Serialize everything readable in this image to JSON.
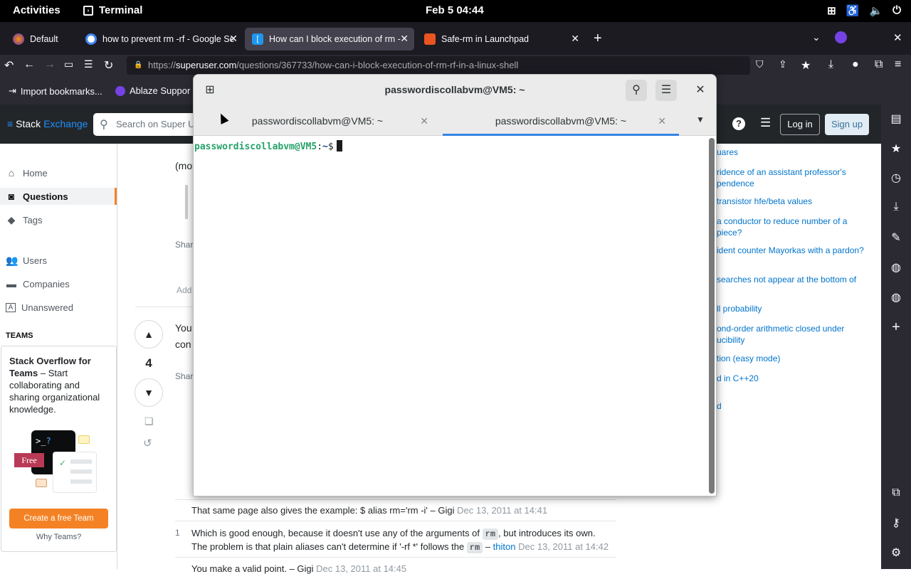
{
  "topbar": {
    "activities": "Activities",
    "app_name": "Terminal",
    "clock": "Feb 5  04:44"
  },
  "browser": {
    "profile_tab": "Default",
    "tabs": [
      {
        "label": "how to prevent rm -rf - Google Se",
        "favicon": "google-icon"
      },
      {
        "label": "How can I block execution of rm -",
        "favicon": "superuser-icon"
      },
      {
        "label": "Safe-rm in Launchpad",
        "favicon": "launchpad-icon"
      }
    ],
    "url_prefix": "https://",
    "url_host": "superuser.com",
    "url_path": "/questions/367733/how-can-i-block-execution-of-rm-rf-in-a-linux-shell",
    "bookmarks": [
      "Import bookmarks...",
      "Ablaze Suppor"
    ]
  },
  "stackexchange": {
    "logo_a": "Stack",
    "logo_b": "Exchange",
    "search_placeholder": "Search on Super U",
    "login": "Log in",
    "signup": "Sign up",
    "nav": [
      {
        "label": "Home",
        "icon": "home-icon"
      },
      {
        "label": "Questions",
        "icon": "questions-icon"
      },
      {
        "label": "Tags",
        "icon": "tag-icon"
      },
      {
        "label": "Users",
        "icon": "users-icon"
      },
      {
        "label": "Companies",
        "icon": "briefcase-icon"
      },
      {
        "label": "Unanswered",
        "icon": "unanswered-icon"
      }
    ],
    "teams_heading": "TEAMS",
    "teams_title": "Stack Overflow for Teams",
    "teams_text": " – Start collaborating and sharing organizational knowledge.",
    "teams_free": "Free",
    "teams_button": "Create a free Team",
    "teams_why": "Why Teams?",
    "post_fragments": {
      "mo": "(mo",
      "share1": "Shar",
      "add": "Add",
      "you": "You",
      "con": "con",
      "share2": "Shar"
    },
    "vote_count": "4",
    "comments": [
      {
        "score": "",
        "text": "That same page also gives the example: $ alias rm='rm -i' – Gigi",
        "date": "Dec 13, 2011 at 14:41"
      },
      {
        "score": "1",
        "line1_a": "Which is good enough, because it doesn't use any of the arguments of ",
        "code": "rm",
        "line1_b": ", but introduces its own.",
        "line2_a": "The problem is that plain aliases can't determine if '-rf *' follows the ",
        "line2_b": " – ",
        "user": "thiton",
        "date": "Dec 13, 2011 at 14:42"
      },
      {
        "score": "",
        "text": "You make a valid point. – Gigi",
        "date": "Dec 13, 2011 at 14:45"
      }
    ],
    "hot_questions": [
      "uares",
      "ridence of an assistant professor's pendence",
      "transistor hfe/beta values",
      "a conductor to reduce number of a piece?",
      "ident counter Mayorkas with a pardon?",
      "searches not appear at the bottom of",
      "ll probability",
      "ond-order arithmetic closed under ucibility",
      "tion (easy mode)",
      "d in C++20",
      "d"
    ]
  },
  "terminal": {
    "title": "passwordiscollabvm@VM5: ~",
    "tabs": [
      "passwordiscollabvm@VM5: ~",
      "passwordiscollabvm@VM5: ~"
    ],
    "prompt_user": "passwordiscollabvm@VM5",
    "prompt_sep": ":",
    "prompt_path": "~",
    "prompt_sym": "$"
  }
}
